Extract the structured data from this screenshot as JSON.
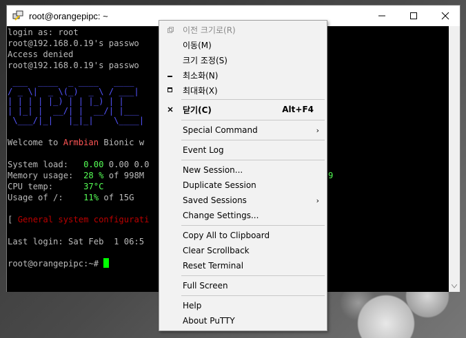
{
  "window": {
    "title": "root@orangepipc: ~"
  },
  "terminal": {
    "line1": "login as: root",
    "line2": "root@192.168.0.19's passwo",
    "line3": "Access denied",
    "line4": "root@192.168.0.19's passwo",
    "banner1": " ___  ____  _ ____   ____",
    "banner2": "/ _ \\|  _ \\(_)  _ \\ / ___|",
    "banner3": "| | | | |_) | | |_) | |",
    "banner4": "| |_| |  __/| |  __/| |___",
    "banner5": " \\___/|_|   |_|_|    \\____|",
    "welcome_prefix": "Welcome to ",
    "welcome_name": "Armbian",
    "welcome_suffix": " Bionic w",
    "sysload_label": "System load:   ",
    "sysload_value": "0.00",
    "sysload_rest": " 0.00 0.0",
    "mem_label": "Memory usage:  ",
    "mem_value": "28 %",
    "mem_rest": " of 998M",
    "mem_tail": "9",
    "cpu_label": "CPU temp:      ",
    "cpu_value": "37°C",
    "usage_label": "Usage of /:    ",
    "usage_value": "11%",
    "usage_rest": " of 15G",
    "config_prefix": "[ ",
    "config_text": "General system configurati",
    "last_login": "Last login: Sat Feb  1 06:5",
    "prompt": "root@orangepipc:~# "
  },
  "menu": {
    "restore": "이전 크기로(R)",
    "move": "이동(M)",
    "size": "크기 조정(S)",
    "minimize": "최소화(N)",
    "maximize": "최대화(X)",
    "close": "닫기(C)",
    "close_shortcut": "Alt+F4",
    "special_command": "Special Command",
    "event_log": "Event Log",
    "new_session": "New Session...",
    "duplicate_session": "Duplicate Session",
    "saved_sessions": "Saved Sessions",
    "change_settings": "Change Settings...",
    "copy_all": "Copy All to Clipboard",
    "clear_scrollback": "Clear Scrollback",
    "reset_terminal": "Reset Terminal",
    "full_screen": "Full Screen",
    "help": "Help",
    "about": "About PuTTY"
  },
  "colors": {
    "terminal_bg": "#000000",
    "terminal_text": "#bbbbbb",
    "green": "#55ff55",
    "red": "#bb0000",
    "cursor": "#00ff00"
  }
}
